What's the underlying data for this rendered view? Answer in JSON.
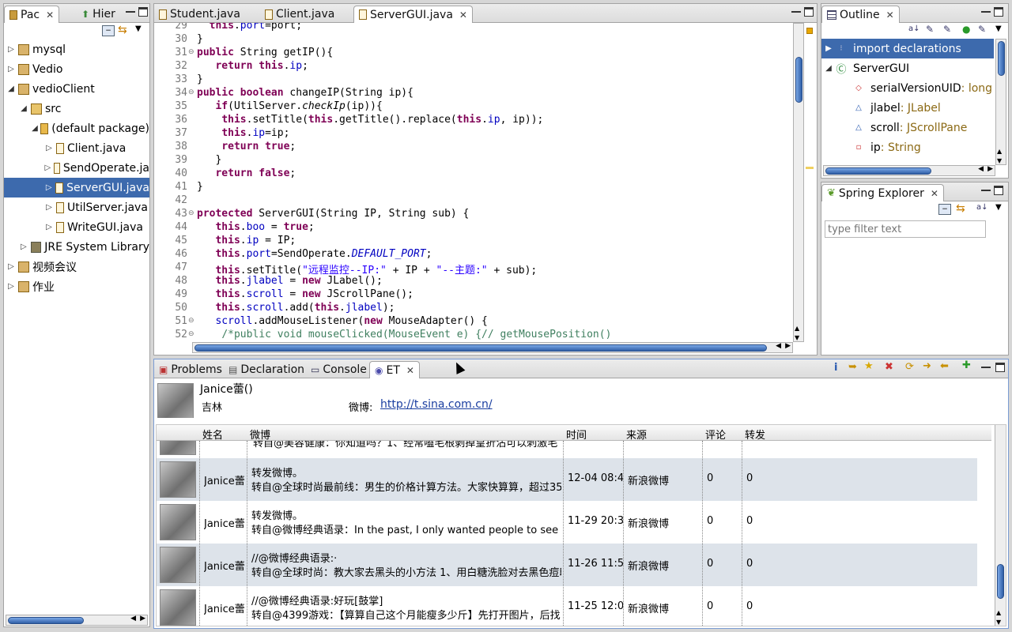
{
  "package_explorer": {
    "tabs": [
      {
        "label": "Pac"
      },
      {
        "label": "Hier"
      }
    ],
    "tree": [
      {
        "label": "mysql",
        "expanded": false,
        "depth": 0
      },
      {
        "label": "Vedio",
        "expanded": false,
        "depth": 0
      },
      {
        "label": "vedioClient",
        "expanded": true,
        "depth": 0
      },
      {
        "label": "src",
        "expanded": true,
        "depth": 1
      },
      {
        "label": "(default package)",
        "expanded": true,
        "depth": 2
      },
      {
        "label": "Client.java",
        "expanded": false,
        "depth": 3
      },
      {
        "label": "SendOperate.ja",
        "expanded": false,
        "depth": 3
      },
      {
        "label": "ServerGUI.java",
        "expanded": false,
        "depth": 3,
        "selected": true
      },
      {
        "label": "UtilServer.java",
        "expanded": false,
        "depth": 3
      },
      {
        "label": "WriteGUI.java",
        "expanded": false,
        "depth": 3
      },
      {
        "label": "JRE System Library",
        "expanded": false,
        "depth": 1
      },
      {
        "label": "视频会议",
        "expanded": false,
        "depth": 0
      },
      {
        "label": "作业",
        "expanded": false,
        "depth": 0
      }
    ]
  },
  "editor": {
    "tabs": [
      {
        "label": "Student.java"
      },
      {
        "label": "Client.java"
      },
      {
        "label": "ServerGUI.java",
        "active": true
      }
    ],
    "lines": [
      {
        "n": "29",
        "html": "  <span class=\"kw\">this</span>.<span class=\"fld\">port</span>=port;"
      },
      {
        "n": "30",
        "html": "}"
      },
      {
        "n": "31",
        "fold": true,
        "html": "<span class=\"kw\">public</span> String getIP(){"
      },
      {
        "n": "32",
        "html": "   <span class=\"kw\">return</span> <span class=\"kw\">this</span>.<span class=\"fld\">ip</span>;"
      },
      {
        "n": "33",
        "html": "}"
      },
      {
        "n": "34",
        "fold": true,
        "html": "<span class=\"kw\">public</span> <span class=\"kw\">boolean</span> changeIP(String ip){"
      },
      {
        "n": "35",
        "html": "   <span class=\"kw\">if</span>(UtilServer.<span class=\"it\">checkIp</span>(ip)){"
      },
      {
        "n": "36",
        "html": "    <span class=\"kw\">this</span>.setTitle(<span class=\"kw\">this</span>.getTitle().replace(<span class=\"kw\">this</span>.<span class=\"fld\">ip</span>, ip));"
      },
      {
        "n": "37",
        "html": "    <span class=\"kw\">this</span>.<span class=\"fld\">ip</span>=ip;"
      },
      {
        "n": "38",
        "html": "    <span class=\"kw\">return</span> <span class=\"kw\">true</span>;"
      },
      {
        "n": "39",
        "html": "   }"
      },
      {
        "n": "40",
        "html": "   <span class=\"kw\">return</span> <span class=\"kw\">false</span>;"
      },
      {
        "n": "41",
        "html": "}"
      },
      {
        "n": "42",
        "html": ""
      },
      {
        "n": "43",
        "fold": true,
        "html": "<span class=\"kw\">protected</span> ServerGUI(String IP, String sub) {"
      },
      {
        "n": "44",
        "html": "   <span class=\"kw\">this</span>.<span class=\"fld\">boo</span> = <span class=\"kw\">true</span>;"
      },
      {
        "n": "45",
        "html": "   <span class=\"kw\">this</span>.<span class=\"fld\">ip</span> = IP;"
      },
      {
        "n": "46",
        "html": "   <span class=\"kw\">this</span>.<span class=\"fld\">port</span>=SendOperate.<span class=\"fld it\">DEFAULT_PORT</span>;"
      },
      {
        "n": "47",
        "html": "   <span class=\"kw\">this</span>.setTitle(<span class=\"str\">\"远程监控--IP:\"</span> + IP + <span class=\"str\">\"--主题:\"</span> + sub);"
      },
      {
        "n": "48",
        "html": "   <span class=\"kw\">this</span>.<span class=\"fld\">jlabel</span> = <span class=\"kw\">new</span> JLabel();"
      },
      {
        "n": "49",
        "html": "   <span class=\"kw\">this</span>.<span class=\"fld\">scroll</span> = <span class=\"kw\">new</span> JScrollPane();"
      },
      {
        "n": "50",
        "html": "   <span class=\"kw\">this</span>.<span class=\"fld\">scroll</span>.add(<span class=\"kw\">this</span>.<span class=\"fld\">jlabel</span>);"
      },
      {
        "n": "51",
        "fold": true,
        "html": "   <span class=\"fld\">scroll</span>.addMouseListener(<span class=\"kw\">new</span> MouseAdapter() {"
      },
      {
        "n": "52",
        "fold": true,
        "html": "    <span class=\"cm\">/*public void mouseClicked(MouseEvent e) {// getMousePosition()</span>"
      }
    ]
  },
  "outline": {
    "tab": "Outline",
    "items": [
      {
        "label": "import declarations",
        "type": "",
        "depth": 0,
        "selected": true,
        "icon": "import-icon"
      },
      {
        "label": "ServerGUI",
        "type": "",
        "depth": 0,
        "icon": "class-icon"
      },
      {
        "label": "serialVersionUID",
        "type": " : long",
        "depth": 1,
        "icon": "static-final-field-icon"
      },
      {
        "label": "jlabel",
        "type": " : JLabel",
        "depth": 1,
        "icon": "default-field-icon"
      },
      {
        "label": "scroll",
        "type": " : JScrollPane",
        "depth": 1,
        "icon": "default-field-icon"
      },
      {
        "label": "ip",
        "type": " : String",
        "depth": 1,
        "icon": "private-field-icon"
      }
    ]
  },
  "spring": {
    "tab": "Spring Explorer",
    "filter_placeholder": "type filter text"
  },
  "bottom": {
    "tabs": [
      {
        "label": "Problems"
      },
      {
        "label": "Declaration"
      },
      {
        "label": "Console"
      },
      {
        "label": "ET",
        "active": true
      }
    ],
    "profile": {
      "name": "Janice蕾()",
      "location": "吉林",
      "weibo_label": "微博:",
      "weibo_link": "http://t.sina.com.cn/"
    },
    "columns": [
      "姓名",
      "微博",
      "时间",
      "来源",
      "评论",
      "转发"
    ],
    "partial_row_text": "转自@美容健康：你知道吗？1、经常嗑毛根剥掉皇折沾可以刺激毛",
    "rows": [
      {
        "name": "Janice蕾",
        "line1": "转发微博。",
        "line2": "转自@全球时尚最前线：男生的价格计算方法。大家快算算，超过35",
        "time": "12-04 08:4",
        "source": "新浪微博",
        "comments": "0",
        "reposts": "0"
      },
      {
        "name": "Janice蕾",
        "line1": "转发微博。",
        "line2": "转自@微博经典语录：In the past, I only wanted people to see",
        "time": "11-29 20:3",
        "source": "新浪微博",
        "comments": "0",
        "reposts": "0"
      },
      {
        "name": "Janice蕾",
        "line1": "//@微博经典语录:·",
        "line2": "转自@全球时尚：教大家去黑头的小方法 1、用白糖洗脸对去黑色痘印",
        "time": "11-26 11:5",
        "source": "新浪微博",
        "comments": "0",
        "reposts": "0"
      },
      {
        "name": "Janice蕾",
        "line1": "//@微博经典语录:好玩[鼓掌]",
        "line2": "转自@4399游戏：【算算自己这个月能瘦多少斤】先打开图片，后找",
        "time": "11-25 12:0",
        "source": "新浪微博",
        "comments": "0",
        "reposts": "0"
      }
    ]
  }
}
